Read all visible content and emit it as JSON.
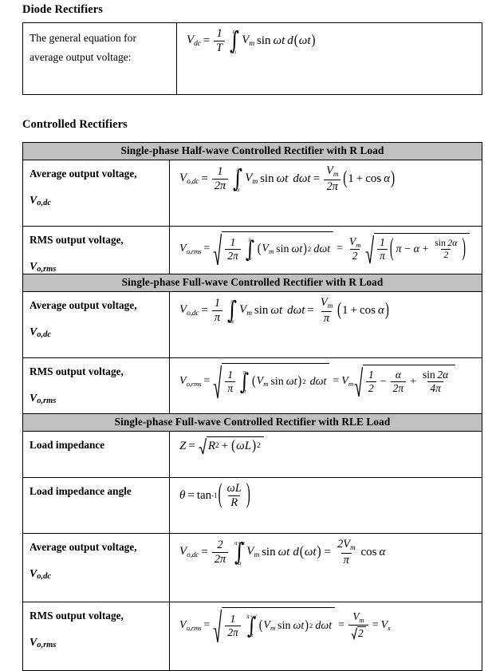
{
  "document": {
    "headings": {
      "diode": "Diode Rectifiers",
      "controlled": "Controlled Rectifiers"
    }
  },
  "diode_table": {
    "rows": [
      {
        "label_line1": "The general equation for",
        "label_line2": "average output voltage:",
        "formula_text": "V_dc = (1/T) ∫ from t1 to t2 of V_m sin ωt d(ωt)",
        "parts": {
          "lhs": "V",
          "lhs_sub": "dc",
          "equals": "=",
          "frac_num": "1",
          "frac_den": "T",
          "int_upper": "t",
          "int_upper_sub": "2",
          "int_lower": "t",
          "int_lower_sub": "1",
          "vm": "V",
          "vm_sub": "m",
          "sin": "sin",
          "omega_t": "ωt",
          "d": "d",
          "d_arg": "ωt"
        }
      }
    ]
  },
  "controlled_tables": [
    {
      "id": "half-wave-r",
      "header": "Single-phase Half-wave Controlled Rectifier with R Load",
      "rows": [
        {
          "label": "Average output voltage,",
          "label_var": "V",
          "label_var_sub": "o,dc",
          "formula_text": "V_o,dc = (1/2π) ∫ from α to π of V_m sin ωt dωt = (V_m/2π)(1 + cos α)",
          "parts": {
            "lhs": "V",
            "lhs_sub": "o,dc",
            "frac_num": "1",
            "frac_den": "2π",
            "int_upper": "π",
            "int_lower": "α",
            "vm": "V",
            "vm_sub": "m",
            "sin": "sin",
            "omega_t": "ωt",
            "d_omega_t": "dωt",
            "res_num": "V",
            "res_num_sub": "m",
            "res_den": "2π",
            "tail": "1 + cos α"
          }
        },
        {
          "label": "RMS output voltage,",
          "label_var": "V",
          "label_var_sub": "o,rms",
          "formula_text": "V_o,rms = sqrt[(1/2π) ∫ from α to π of (V_m sin ωt)^2 dωt] = (V_m/2) sqrt[(1/π)(π − α + sin2α/2)]",
          "parts": {
            "lhs": "V",
            "lhs_sub": "o,rms",
            "frac_num": "1",
            "frac_den": "2π",
            "int_upper": "π",
            "int_lower": "α",
            "vm": "V",
            "vm_sub": "m",
            "sin": "sin",
            "omega_t": "ωt",
            "power": "2",
            "d_omega_t": "dωt",
            "res_num": "V",
            "res_num_sub": "m",
            "res_den": "2",
            "inner_frac_num": "1",
            "inner_frac_den": "π",
            "inner_expr_a": "π − α +",
            "sin2a_num": "sin 2α",
            "sin2a_den": "2"
          }
        }
      ]
    },
    {
      "id": "full-wave-r",
      "header": "Single-phase Full-wave Controlled Rectifier with R Load",
      "rows": [
        {
          "label": "Average output voltage,",
          "label_var": "V",
          "label_var_sub": "o,dc",
          "formula_text": "V_o,dc = (1/π) ∫ from α to π of V_m sin ωt dωt = (V_m/π)(1 + cos α)",
          "parts": {
            "lhs": "V",
            "lhs_sub": "o,dc",
            "frac_num": "1",
            "frac_den": "π",
            "int_upper": "π",
            "int_lower": "α",
            "vm": "V",
            "vm_sub": "m",
            "sin": "sin",
            "omega_t": "ωt",
            "d_omega_t": "dωt",
            "res_num": "V",
            "res_num_sub": "m",
            "res_den": "π",
            "tail": "1 + cos α"
          }
        },
        {
          "label": "RMS output voltage,",
          "label_var": "V",
          "label_var_sub": "o,rms",
          "formula_text": "V_o,rms = sqrt[(1/π) ∫ from α to π of (V_m sin ωt)^2 dωt] = V_m sqrt[1/2 − α/2π + sin2α/4π]",
          "parts": {
            "lhs": "V",
            "lhs_sub": "o,rms",
            "frac_num": "1",
            "frac_den": "π",
            "int_upper": "π",
            "int_lower": "α",
            "vm": "V",
            "vm_sub": "m",
            "sin": "sin",
            "omega_t": "ωt",
            "power": "2",
            "d_omega_t": "dωt",
            "res_vm": "V",
            "res_vm_sub": "m",
            "t1_num": "1",
            "t1_den": "2",
            "minus": "−",
            "t2_num": "α",
            "t2_den": "2π",
            "plus": "+",
            "t3_num": "sin 2α",
            "t3_den": "4π"
          }
        }
      ]
    },
    {
      "id": "full-wave-rle",
      "header": "Single-phase Full-wave Controlled Rectifier with RLE Load",
      "rows": [
        {
          "label": "Load impedance",
          "label_var": "",
          "label_var_sub": "",
          "formula_text": "Z = sqrt(R^2 + (ωL)^2)",
          "parts": {
            "lhs": "Z",
            "r": "R",
            "r_pow": "2",
            "plus": "+",
            "omega_l": "ωL",
            "ol_pow": "2"
          }
        },
        {
          "label": "Load impedance angle",
          "label_var": "",
          "label_var_sub": "",
          "formula_text": "θ = tan^-1(ωL / R)",
          "parts": {
            "lhs": "θ",
            "tan": "tan",
            "tan_pow": "-1",
            "frac_num": "ωL",
            "frac_den": "R"
          }
        },
        {
          "label": "Average output voltage,",
          "label_var": "V",
          "label_var_sub": "o,dc",
          "formula_text": "V_o,dc = (2/2π) ∫ from α to π+α of V_m sin ωt d(ωt) = (2V_m/π) cos α",
          "parts": {
            "lhs": "V",
            "lhs_sub": "o,dc",
            "frac_num": "2",
            "frac_den": "2π",
            "int_upper": "π+α",
            "int_lower": "α",
            "vm": "V",
            "vm_sub": "m",
            "sin": "sin",
            "omega_t": "ωt",
            "d": "d",
            "d_arg": "ωt",
            "res_num": "2V",
            "res_num_sub": "m",
            "res_den": "π",
            "cos": "cos α"
          }
        },
        {
          "label": "RMS output voltage,",
          "label_var": "V",
          "label_var_sub": "o,rms",
          "formula_text": "V_o,rms = sqrt[(1/2π) ∫ from α to π+α of (V_m sin ωt)^2 dωt] = V_m/√2 = V_s",
          "parts": {
            "lhs": "V",
            "lhs_sub": "o,rms",
            "frac_num": "1",
            "frac_den": "2π",
            "int_upper": "π+α",
            "int_lower": "α",
            "vm": "V",
            "vm_sub": "m",
            "sin": "sin",
            "omega_t": "ωt",
            "power": "2",
            "d_omega_t": "dωt",
            "res_num": "V",
            "res_num_sub": "m",
            "res_den_radical": "√2",
            "res_den": "2",
            "final": "V",
            "final_sub": "s"
          }
        }
      ]
    }
  ],
  "style": {
    "header_fill": "#c0c0c0",
    "border_color": "#000000",
    "text_color": "#000000",
    "background": "#ffffff"
  }
}
